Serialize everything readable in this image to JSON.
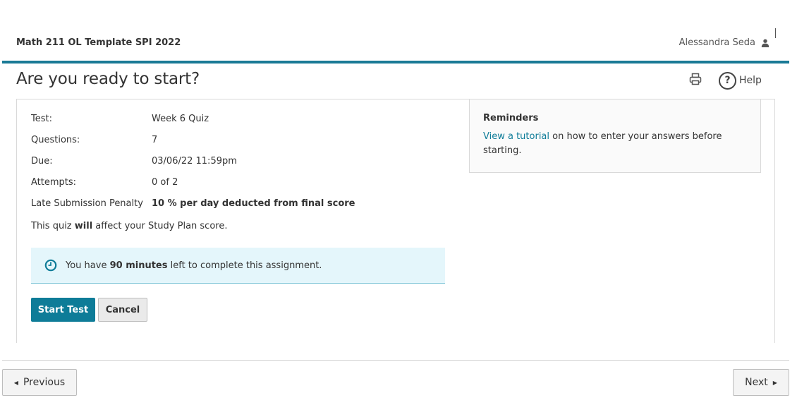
{
  "header": {
    "course_title": "Math 211 OL Template SPI 2022",
    "user_name": "Alessandra Seda",
    "user_icon": "user-icon"
  },
  "page": {
    "title": "Are you ready to start?",
    "print_icon": "print-icon",
    "help_label": "Help",
    "help_glyph": "?"
  },
  "test_info": [
    {
      "label": "Test:",
      "value": "Week 6 Quiz",
      "bold": false
    },
    {
      "label": "Questions:",
      "value": "7",
      "bold": false
    },
    {
      "label": "Due:",
      "value": "03/06/22 11:59pm",
      "bold": false
    },
    {
      "label": "Attempts:",
      "value": "0 of 2",
      "bold": false
    },
    {
      "label": "Late Submission Penalty",
      "value": "10 % per day deducted from final score",
      "bold": true
    }
  ],
  "study_note": {
    "prefix": "This quiz ",
    "emphasis": "will",
    "suffix": " affect your Study Plan score."
  },
  "timer": {
    "icon": "clock-icon",
    "prefix": "You have ",
    "emphasis": "90 minutes",
    "suffix": " left to complete this assignment."
  },
  "actions": {
    "start_label": "Start Test",
    "cancel_label": "Cancel"
  },
  "reminders": {
    "title": "Reminders",
    "link_text": "View a tutorial",
    "text_after_link": " on how to enter your answers before starting."
  },
  "navigation": {
    "previous_label": "Previous",
    "next_label": "Next"
  },
  "colors": {
    "accent": "#0e7c98",
    "header_rule": "#1a7a96",
    "timer_bg": "#e4f6fb"
  }
}
